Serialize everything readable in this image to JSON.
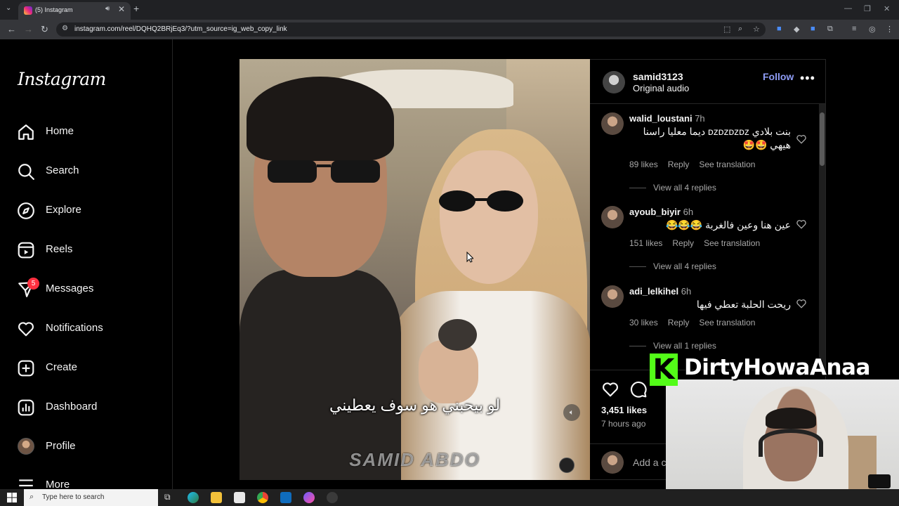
{
  "browser": {
    "tab_title": "(5) Instagram",
    "url": "instagram.com/reel/DQHQ2BRjEq3/?utm_source=ig_web_copy_link"
  },
  "sidebar": {
    "logo": "Instagram",
    "items": [
      {
        "label": "Home"
      },
      {
        "label": "Search"
      },
      {
        "label": "Explore"
      },
      {
        "label": "Reels"
      },
      {
        "label": "Messages",
        "badge": "5"
      },
      {
        "label": "Notifications"
      },
      {
        "label": "Create"
      },
      {
        "label": "Dashboard"
      },
      {
        "label": "Profile"
      },
      {
        "label": "More"
      }
    ]
  },
  "reel": {
    "subtitle": "لو بيحبني هو سوف يعطيني",
    "watermark": "SAMID ABDO"
  },
  "post": {
    "owner": "samid3123",
    "audio": "Original audio",
    "follow_label": "Follow",
    "more_label": "•••",
    "likes": "3,451 likes",
    "posted": "7 hours ago",
    "add_comment_placeholder": "Add a c"
  },
  "comments": [
    {
      "user": "walid_loustani",
      "time": "7h",
      "text": "بنت بلادي ᴅᴢᴅᴢᴅᴢᴅᴢ ديما معليا راسنا هيهي 🤩🤩",
      "likes": "89 likes",
      "reply": "Reply",
      "translate": "See translation",
      "replies": "View all 4 replies"
    },
    {
      "user": "ayoub_biyir",
      "time": "6h",
      "text": "عين هنا وعين فالغربة 😂😂😂",
      "likes": "151 likes",
      "reply": "Reply",
      "translate": "See translation",
      "replies": "View all 4 replies"
    },
    {
      "user": "adi_lelkihel",
      "time": "6h",
      "text": "ريحت الحلبة تعطي فيها",
      "likes": "30 likes",
      "reply": "Reply",
      "translate": "See translation",
      "replies": "View all 1 replies"
    }
  ],
  "overlay": {
    "channel": "DirtyHowaAnaa",
    "logo_letter": "K",
    "brand_color": "#53fc18"
  },
  "taskbar": {
    "search_placeholder": "Type here to search"
  },
  "colors": {
    "follow": "#8e9cf5",
    "badge": "#ff3040",
    "bg": "#000000"
  }
}
